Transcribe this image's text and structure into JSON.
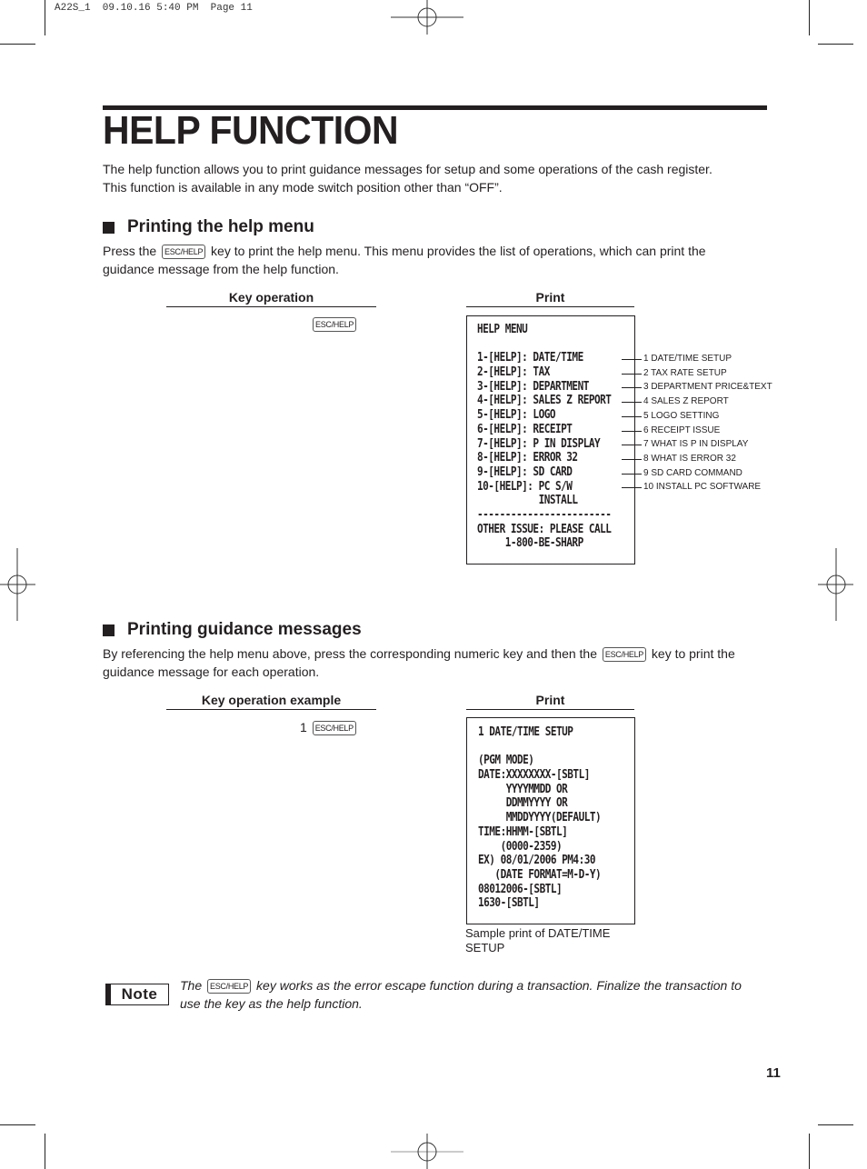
{
  "print_slug": "A22S_1  09.10.16 5:40 PM  Page 11",
  "title": "HELP FUNCTION",
  "intro": [
    "The help function allows you to print guidance messages for setup and some operations of the cash register.",
    "This function is available in any mode switch position other than “OFF”."
  ],
  "section1": {
    "heading": "Printing the help menu",
    "text_before_key": "Press the",
    "key_label": "ESC/HELP",
    "text_after_key": "key to print the help menu.  This menu provides the list of operations, which can print the",
    "text_line2": "guidance message from the help function.",
    "key_operation_header": "Key operation",
    "print_header": "Print",
    "key_sequence": "ESC/HELP",
    "receipt_lines": [
      "HELP MENU",
      "",
      "1-[HELP]: DATE/TIME",
      "2-[HELP]: TAX",
      "3-[HELP]: DEPARTMENT",
      "4-[HELP]: SALES Z REPORT",
      "5-[HELP]: LOGO",
      "6-[HELP]: RECEIPT",
      "7-[HELP]: P IN DISPLAY",
      "8-[HELP]: ERROR 32",
      "9-[HELP]: SD CARD",
      "10-[HELP]: PC S/W",
      "           INSTALL",
      "------------------------",
      "OTHER ISSUE: PLEASE CALL",
      "     1-800-BE-SHARP"
    ],
    "annotations": [
      "1 DATE/TIME SETUP",
      "2 TAX RATE SETUP",
      "3 DEPARTMENT PRICE&TEXT",
      "4 SALES Z REPORT",
      "5 LOGO SETTING",
      "6 RECEIPT ISSUE",
      "7 WHAT IS P IN DISPLAY",
      "8 WHAT IS ERROR 32",
      "9 SD CARD COMMAND",
      "10 INSTALL PC SOFTWARE"
    ]
  },
  "section2": {
    "heading": "Printing guidance messages",
    "text_before_key": "By referencing the help menu above, press the corresponding numeric key and then the",
    "key_label": "ESC/HELP",
    "text_after_key": "key to print the",
    "text_line2": "guidance message for each operation.",
    "key_operation_header": "Key operation example",
    "print_header": "Print",
    "key_digit": "1",
    "key_sequence": "ESC/HELP",
    "receipt_lines": [
      "1 DATE/TIME SETUP",
      "",
      "(PGM MODE)",
      "DATE:XXXXXXXX-[SBTL]",
      "     YYYYMMDD OR",
      "     DDMMYYYY OR",
      "     MMDDYYYY(DEFAULT)",
      "TIME:HHMM-[SBTL]",
      "    (0000-2359)",
      "EX) 08/01/2006 PM4:30",
      "   (DATE FORMAT=M-D-Y)",
      "08012006-[SBTL]",
      "1630-[SBTL]"
    ],
    "caption": [
      "Sample print of DATE/TIME",
      "SETUP"
    ]
  },
  "note": {
    "badge": "Note",
    "text_before_key": "The",
    "key_label": "ESC/HELP",
    "text_after_key": "key works as the error escape function during a transaction. Finalize the transaction to",
    "text_line2": "use the key as the help function."
  },
  "page_number": "11"
}
